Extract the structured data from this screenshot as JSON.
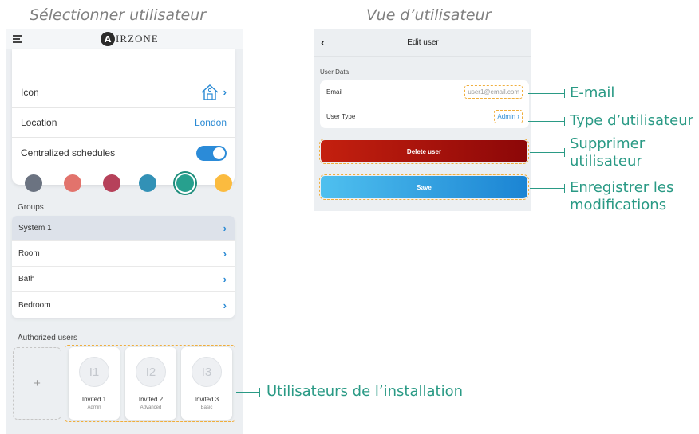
{
  "captions": {
    "left": "Sélectionner utilisateur",
    "right": "Vue d’utilisateur"
  },
  "left_screen": {
    "logo_mark": "A",
    "logo_text": "IRZONE",
    "settings": {
      "icon_label": "Icon",
      "location_label": "Location",
      "location_value": "London",
      "schedules_label": "Centralized schedules",
      "schedules_on": true,
      "colors": [
        "#6b7381",
        "#e2736c",
        "#b6415a",
        "#3291b6",
        "#27a08e",
        "#fbbb3f"
      ],
      "selected_color_index": 4
    },
    "groups": {
      "title": "Groups",
      "items": [
        "System 1",
        "Room",
        "Bath",
        "Bedroom"
      ]
    },
    "authorized": {
      "title": "Authorized users",
      "add_label": "+",
      "users": [
        {
          "initials": "I1",
          "name": "Invited 1",
          "role": "Admin"
        },
        {
          "initials": "I2",
          "name": "Invited 2",
          "role": "Advanced"
        },
        {
          "initials": "I3",
          "name": "Invited 3",
          "role": "Basic"
        }
      ]
    }
  },
  "right_screen": {
    "back_icon": "‹",
    "title": "Edit user",
    "section_title": "User Data",
    "email_label": "Email",
    "email_value": "user1@email.com",
    "type_label": "User Type",
    "type_value": "Admin",
    "delete_label": "Delete user",
    "save_label": "Save"
  },
  "callouts": {
    "email": "E-mail",
    "type": "Type d’utilisateur",
    "delete_1": "Supprimer",
    "delete_2": "utilisateur",
    "save_1": "Enregistrer les",
    "save_2": "modifications",
    "users": "Utilisateurs de l’installation"
  },
  "accent_color": "#2a9a85",
  "highlight_color": "#f0ae3c"
}
